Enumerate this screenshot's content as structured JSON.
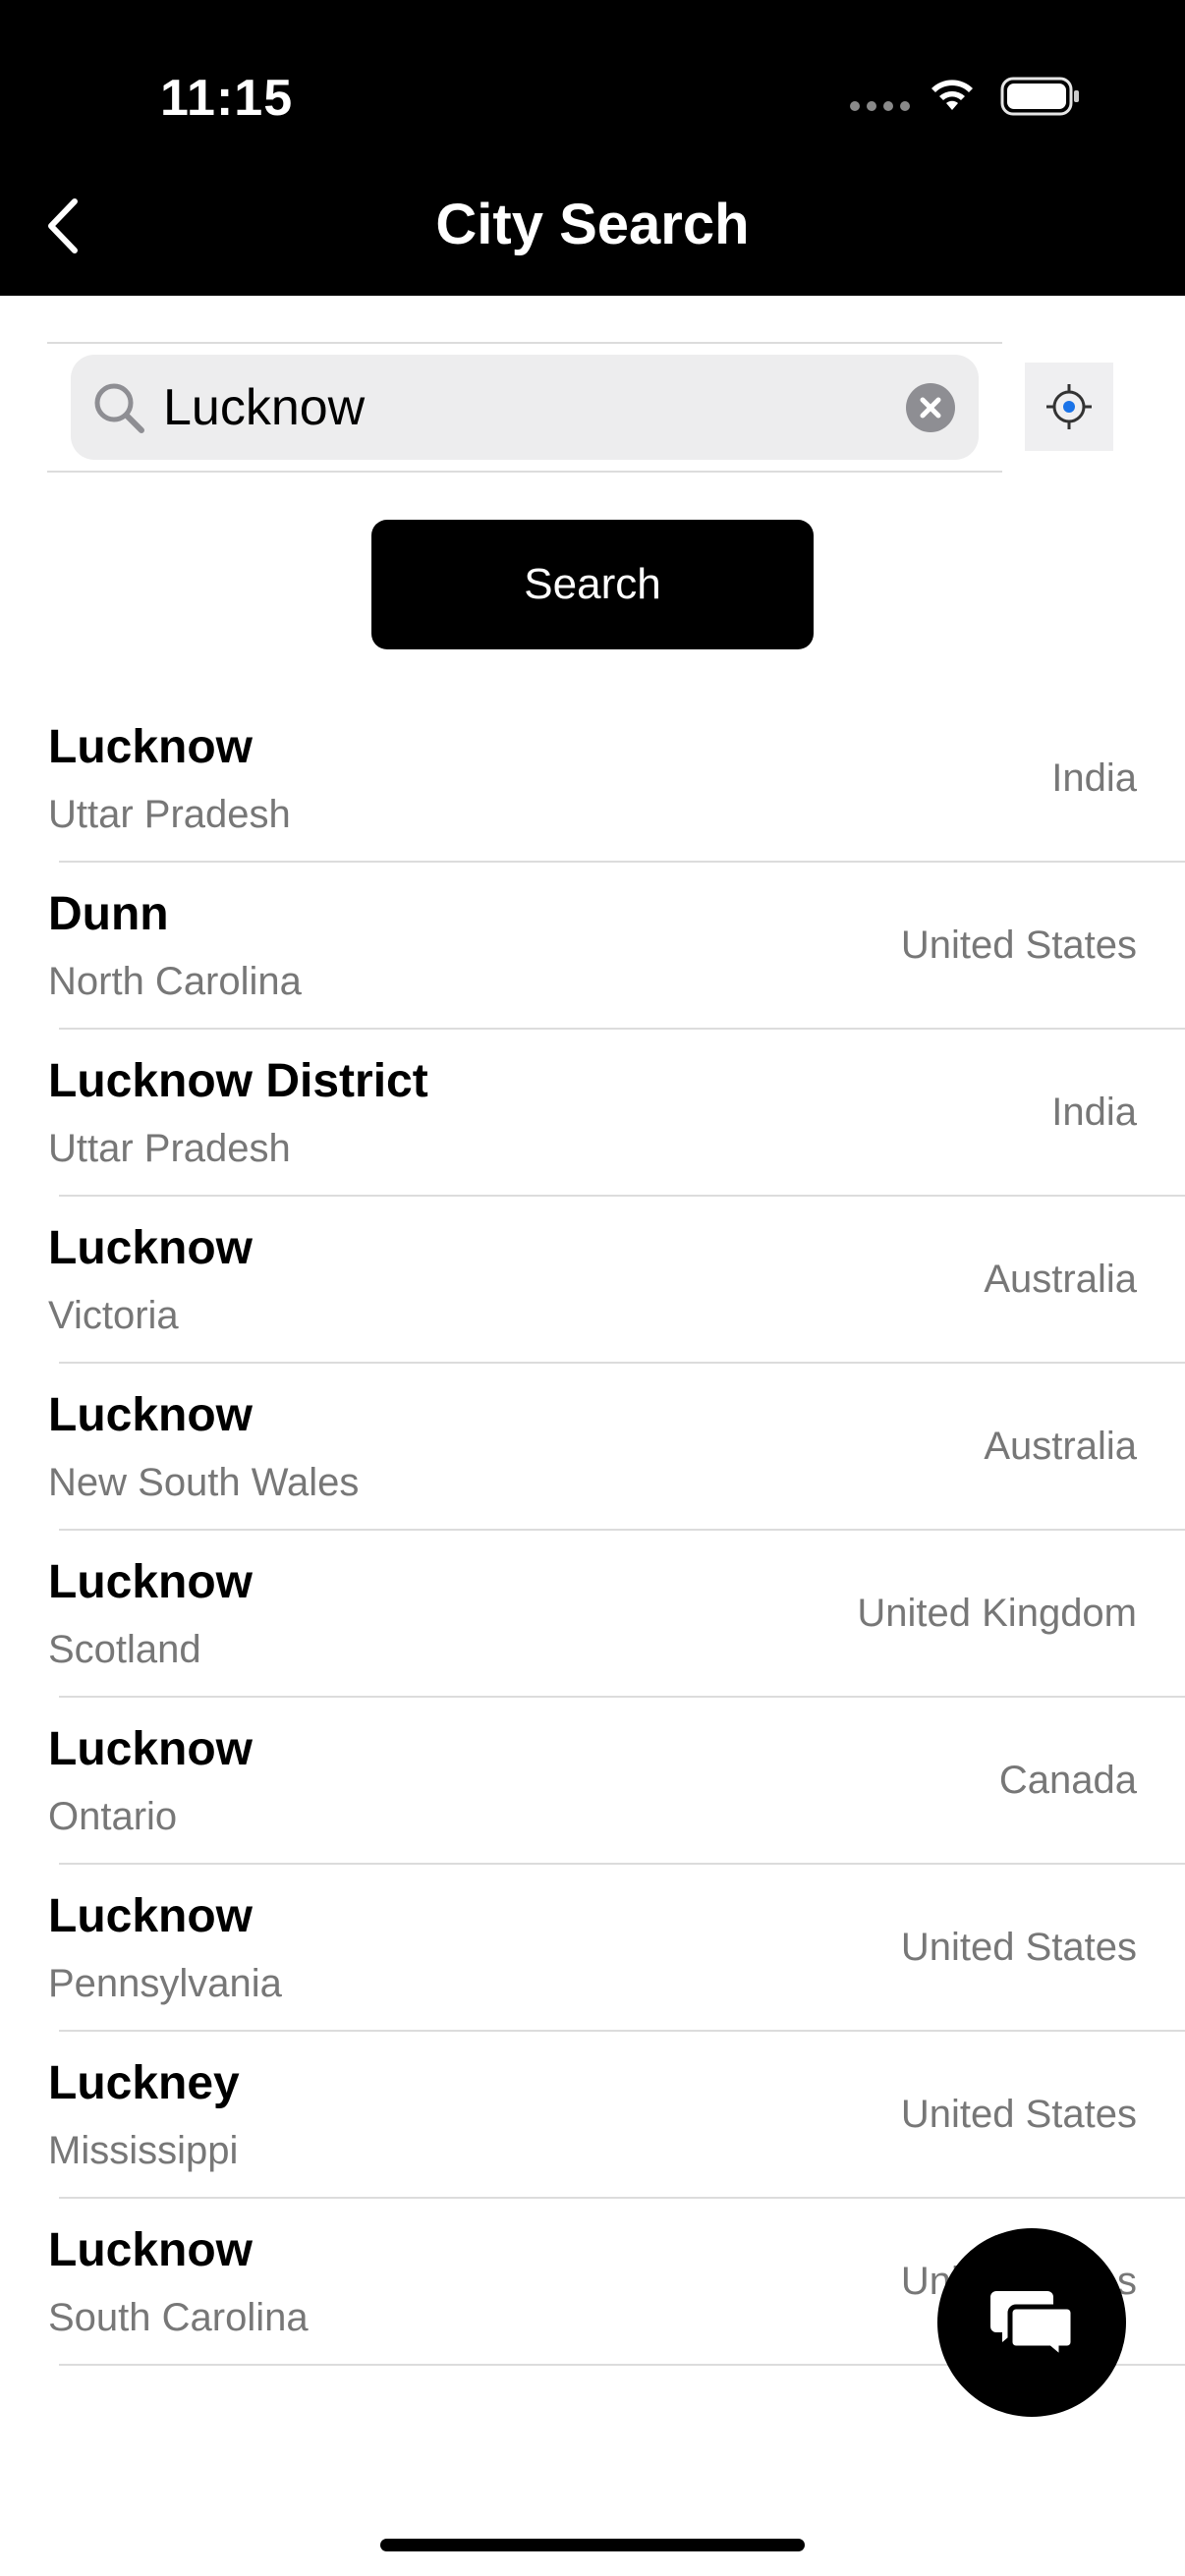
{
  "status_bar": {
    "time": "11:15"
  },
  "nav": {
    "title": "City Search",
    "back_icon": "chevron-left-icon"
  },
  "search": {
    "value": "Lucknow",
    "icon": "search-icon",
    "clear_icon": "clear-icon",
    "locate_icon": "location-target-icon",
    "button_label": "Search"
  },
  "results": [
    {
      "city": "Lucknow",
      "region": "Uttar Pradesh",
      "country": "India"
    },
    {
      "city": "Dunn",
      "region": "North Carolina",
      "country": "United States"
    },
    {
      "city": "Lucknow District",
      "region": "Uttar Pradesh",
      "country": "India"
    },
    {
      "city": "Lucknow",
      "region": "Victoria",
      "country": "Australia"
    },
    {
      "city": "Lucknow",
      "region": "New South Wales",
      "country": "Australia"
    },
    {
      "city": "Lucknow",
      "region": "Scotland",
      "country": "United Kingdom"
    },
    {
      "city": "Lucknow",
      "region": "Ontario",
      "country": "Canada"
    },
    {
      "city": "Lucknow",
      "region": "Pennsylvania",
      "country": "United States"
    },
    {
      "city": "Luckney",
      "region": "Mississippi",
      "country": "United States"
    },
    {
      "city": "Lucknow",
      "region": "South Carolina",
      "country": "United States"
    }
  ],
  "chat": {
    "icon": "chat-bubbles-icon"
  },
  "colors": {
    "header_bg": "#000000",
    "accent": "#1a73e8",
    "secondary_text": "#777777"
  }
}
